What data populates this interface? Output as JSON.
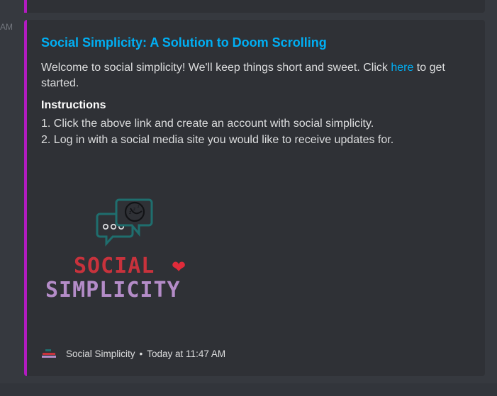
{
  "timestamp_stub": "AM",
  "embed": {
    "title": "Social Simplicity: A Solution to Doom Scrolling",
    "description_before_link": "Welcome to social simplicity! We'll keep things short and sweet. Click ",
    "description_link": "here",
    "description_after_link": " to get started.",
    "instructions_heading": "Instructions",
    "steps": [
      "1. Click the above link and create an account with social simplicity.",
      "2. Log in with a social media site you would like to receive updates for."
    ],
    "logo": {
      "line1": "SOCIAL",
      "line2": "SIMPLICITY",
      "heart_symbol": "❤"
    },
    "footer": {
      "author": "Social Simplicity",
      "separator": "•",
      "time": "Today at 11:47 AM"
    }
  },
  "colors": {
    "accent_bar": "#b21bc0",
    "link": "#00aff4",
    "logo_red": "#c8323c",
    "logo_purple": "#b48cc8",
    "bubble_teal": "#1f6e6e"
  }
}
